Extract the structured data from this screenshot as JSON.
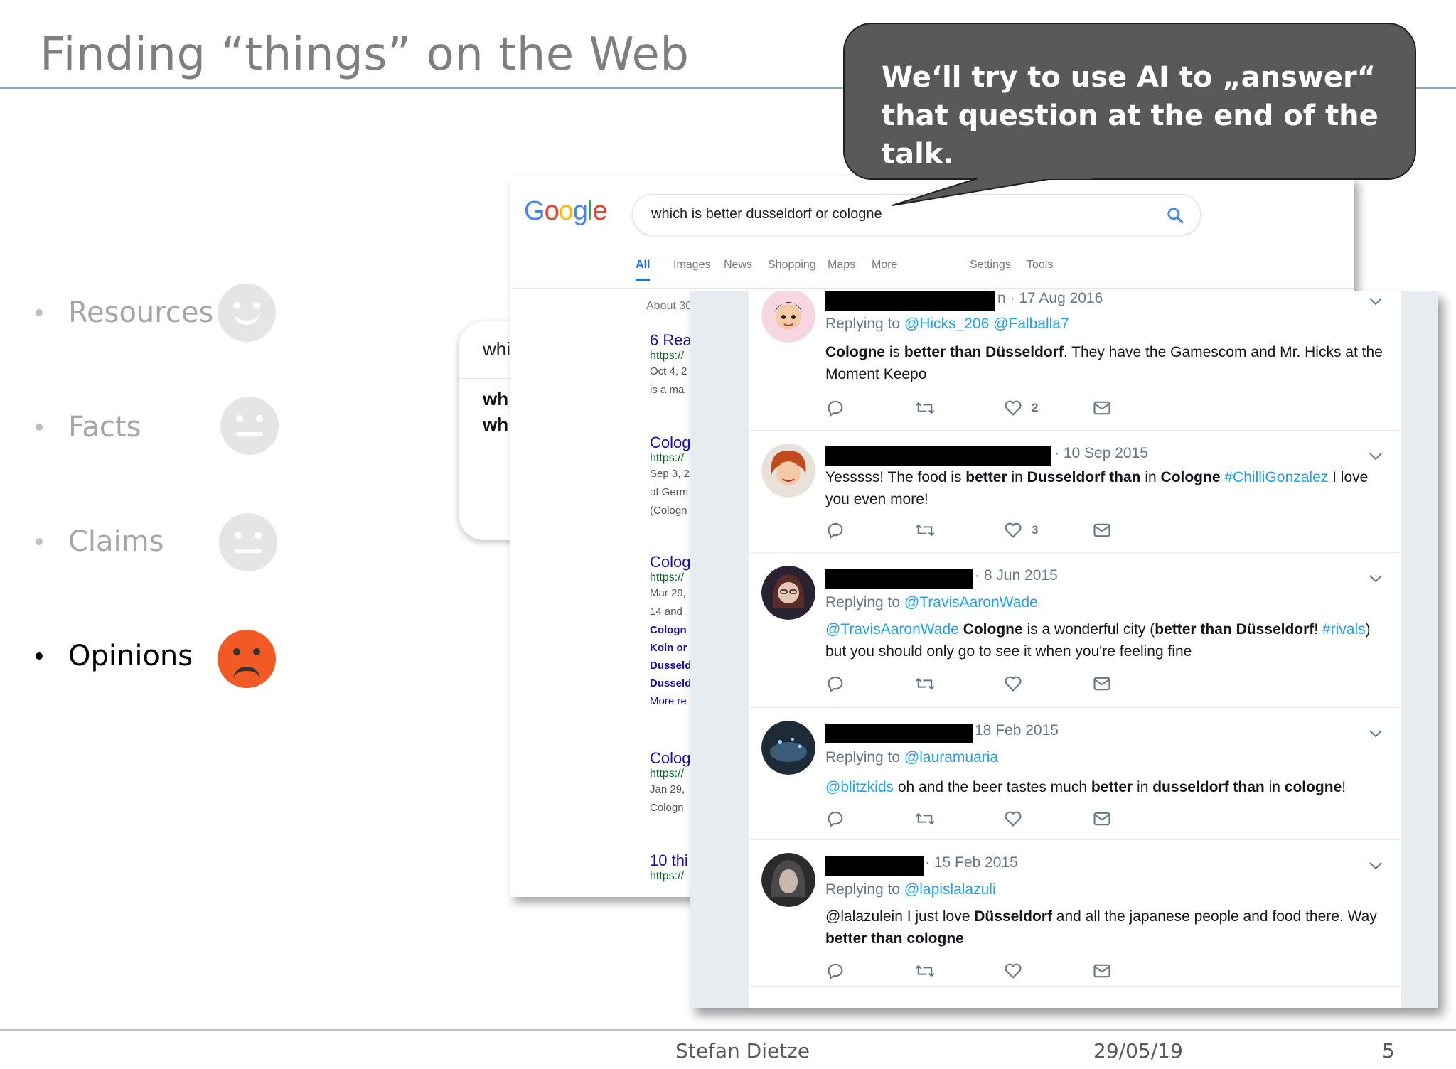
{
  "slide": {
    "title": "Finding “things” on the Web",
    "callout": "We‘ll try to use AI to „answer“ that question at the end of the talk.",
    "bullets": [
      {
        "label": "Resources",
        "face": "happy"
      },
      {
        "label": "Facts",
        "face": "neutral"
      },
      {
        "label": "Claims",
        "face": "neutral"
      },
      {
        "label": "Opinions",
        "face": "sad"
      }
    ],
    "footer": {
      "author": "Stefan Dietze",
      "date": "29/05/19",
      "page": "5"
    }
  },
  "google": {
    "logo": "Google",
    "query": "which is better dusseldorf or cologne",
    "tabs": [
      "All",
      "Images",
      "News",
      "Shopping",
      "Maps",
      "More"
    ],
    "tools": [
      "Settings",
      "Tools"
    ],
    "stats": "About 30",
    "results": [
      {
        "title": "6 Rea",
        "url": "https://",
        "lines": [
          "Oct 4, 2",
          "is a ma"
        ]
      },
      {
        "title": "Colog",
        "url": "https://",
        "lines": [
          "Sep 3, 2",
          "of Germ",
          "(Cologn"
        ]
      },
      {
        "title": "Colog",
        "url": "https://",
        "lines": [
          "Mar 29,",
          "14 and"
        ],
        "bold_links": [
          "Cologn",
          "Koln or",
          "Dusseld",
          "Dusseld"
        ],
        "more": "More re"
      },
      {
        "title": "Colog",
        "url": "https://",
        "lines": [
          "Jan 29,",
          "Cologn"
        ]
      },
      {
        "title": "10 thi",
        "url": "https://",
        "lines": []
      }
    ],
    "autocomplete": {
      "input": "whi",
      "items": [
        "wh",
        "wh"
      ]
    }
  },
  "tweets": [
    {
      "date_prefix": "n · ",
      "date": "17 Aug 2016",
      "reply_label": "Replying to",
      "reply_handles": [
        "@Hicks_206",
        "@Falballa7"
      ],
      "body_parts": [
        [
          "b",
          "Cologne"
        ],
        [
          "t",
          " is "
        ],
        [
          "b",
          "better than Düsseldorf"
        ],
        [
          "t",
          ". They have the Gamescom and Mr. Hicks at the Moment Keepo"
        ]
      ],
      "likes": "2"
    },
    {
      "date_prefix": "· ",
      "date": "10 Sep 2015",
      "reply_label": "",
      "reply_handles": [],
      "body_parts": [
        [
          "t",
          "Yesssss! The food is "
        ],
        [
          "b",
          "better"
        ],
        [
          "t",
          " in "
        ],
        [
          "b",
          "Dusseldorf than"
        ],
        [
          "t",
          " in "
        ],
        [
          "b",
          "Cologne"
        ],
        [
          "t",
          " "
        ],
        [
          "h",
          "#ChilliGonzalez"
        ],
        [
          "t",
          " I love you even more!"
        ]
      ],
      "likes": "3"
    },
    {
      "date_prefix": "· ",
      "date": "8 Jun 2015",
      "reply_label": "Replying to",
      "reply_handles": [
        "@TravisAaronWade"
      ],
      "body_parts": [
        [
          "h",
          "@TravisAaronWade"
        ],
        [
          "t",
          " "
        ],
        [
          "b",
          "Cologne"
        ],
        [
          "t",
          " is a wonderful city ("
        ],
        [
          "b",
          "better than Düsseldorf"
        ],
        [
          "t",
          "! "
        ],
        [
          "h",
          "#rivals"
        ],
        [
          "t",
          ") but you should only go to see it when you're feeling fine"
        ]
      ],
      "likes": ""
    },
    {
      "date_prefix": "",
      "date": "18 Feb 2015",
      "reply_label": "Replying to",
      "reply_handles": [
        "@lauramuaria"
      ],
      "body_parts": [
        [
          "h",
          "@blitzkids"
        ],
        [
          "t",
          " oh and the beer tastes much "
        ],
        [
          "b",
          "better"
        ],
        [
          "t",
          " in "
        ],
        [
          "b",
          "dusseldorf than"
        ],
        [
          "t",
          " in "
        ],
        [
          "b",
          "cologne"
        ],
        [
          "t",
          "!"
        ]
      ],
      "likes": ""
    },
    {
      "date_prefix": "· ",
      "date": "15 Feb 2015",
      "reply_label": "Replying to",
      "reply_handles": [
        "@lapislalazuli"
      ],
      "body_parts": [
        [
          "t",
          "@lalazulein I just love "
        ],
        [
          "b",
          "Düsseldorf"
        ],
        [
          "t",
          " and all the japanese people and food there. Way "
        ],
        [
          "b",
          "better than cologne"
        ]
      ],
      "likes": ""
    }
  ],
  "icons": [
    "happy-face-icon",
    "neutral-face-icon",
    "sad-face-icon",
    "search-icon",
    "chevron-down-icon",
    "reply-icon",
    "retweet-icon",
    "like-icon",
    "message-icon"
  ],
  "colors": {
    "google_blue": "#4285F4",
    "google_red": "#EA4335",
    "google_yellow": "#FBBC05",
    "google_green": "#34A853",
    "twitter_blue": "#1da1f2",
    "sad_face": "#f15a24",
    "callout_bg": "#595959"
  }
}
